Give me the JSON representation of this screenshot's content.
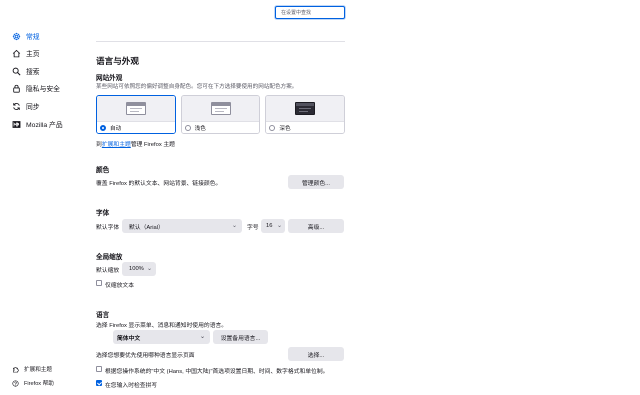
{
  "search": {
    "placeholder": "在设置中查找"
  },
  "sidebar": {
    "items": [
      {
        "label": "常规",
        "icon": "gear-icon",
        "active": true
      },
      {
        "label": "主页",
        "icon": "home-icon"
      },
      {
        "label": "搜索",
        "icon": "search-icon"
      },
      {
        "label": "隐私与安全",
        "icon": "lock-icon"
      },
      {
        "label": "同步",
        "icon": "sync-icon"
      },
      {
        "label": "Mozilla 产品",
        "icon": "mozilla-icon"
      }
    ],
    "footer": [
      {
        "label": "扩展和主题",
        "icon": "puzzle-icon"
      },
      {
        "label": "Firefox 帮助",
        "icon": "help-icon"
      }
    ]
  },
  "language_appearance": {
    "title": "语言与外观",
    "website_appearance": {
      "title": "网站外观",
      "description": "某些网站可依照您的偏好调整自身配色。您可在下方选择要使用的网站配色方案。",
      "options": [
        {
          "label": "自动",
          "selected": true
        },
        {
          "label": "浅色",
          "selected": false
        },
        {
          "label": "深色",
          "selected": false
        }
      ],
      "manage_prefix": "到",
      "manage_link": "扩展和主题",
      "manage_suffix": "管理 Firefox 主题"
    },
    "colors": {
      "title": "颜色",
      "description": "覆盖 Firefox 的默认文本、网站背景、链接颜色。",
      "button": "管理颜色..."
    },
    "fonts": {
      "title": "字体",
      "default_font_label": "默认字体",
      "default_font_value": "默认（Arial）",
      "size_label": "字号",
      "size_value": "16",
      "advanced_button": "高级..."
    },
    "zoom": {
      "title": "全局缩放",
      "default_zoom_label": "默认缩放",
      "default_zoom_value": "100%",
      "text_only_label": "仅缩放文本",
      "text_only_checked": false
    },
    "language": {
      "title": "语言",
      "description": "选择 Firefox 显示菜单、消息和通知时使用的语言。",
      "language_value": "简体中文",
      "alternatives_button": "设置备用语言...",
      "page_lang_label": "选择您想要优先使用哪种语言显示页面",
      "choose_button": "选择...",
      "regional_label": "根据您操作系统的\"中文 (Hans, 中国大陆)\"首选项设置日期、时间、数字格式和单位制。",
      "regional_checked": false,
      "spellcheck_label": "在您输入时检查拼写",
      "spellcheck_checked": true
    }
  },
  "colors": {
    "accent": "#0061e0",
    "text": "#15141a",
    "button_bg": "#e6e6eb"
  }
}
